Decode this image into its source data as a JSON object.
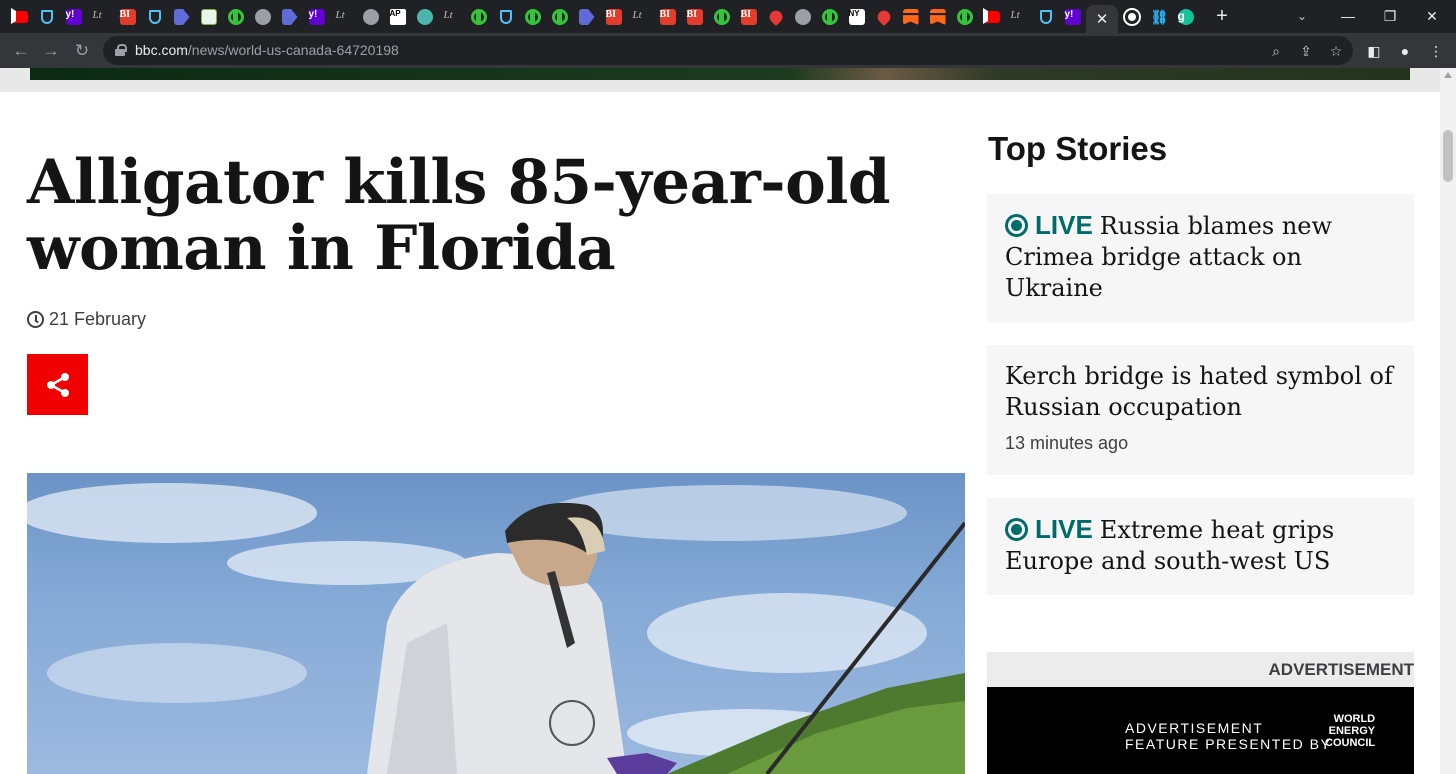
{
  "browser": {
    "tabs": [
      {
        "icon": "youtube-icon"
      },
      {
        "icon": "shield-icon"
      },
      {
        "icon": "yahoo-icon",
        "glyph": "y!"
      },
      {
        "icon": "lt-icon",
        "glyph": "Lt"
      },
      {
        "icon": "business-insider-icon",
        "glyph": "BI"
      },
      {
        "icon": "shield-icon"
      },
      {
        "icon": "arrow-icon"
      },
      {
        "icon": "grid-icon"
      },
      {
        "icon": "rumble-icon"
      },
      {
        "icon": "globe-icon"
      },
      {
        "icon": "arrow-icon"
      },
      {
        "icon": "yahoo-icon",
        "glyph": "y!"
      },
      {
        "icon": "lt-icon",
        "glyph": "Lt"
      },
      {
        "icon": "globe-icon"
      },
      {
        "icon": "ap-icon",
        "glyph": "AP"
      },
      {
        "icon": "teal-icon"
      },
      {
        "icon": "lt-icon",
        "glyph": "Lt"
      },
      {
        "icon": "rumble-icon"
      },
      {
        "icon": "shield-icon"
      },
      {
        "icon": "rumble-icon"
      },
      {
        "icon": "rumble-icon"
      },
      {
        "icon": "arrow-icon"
      },
      {
        "icon": "business-insider-icon",
        "glyph": "BI"
      },
      {
        "icon": "lt-icon",
        "glyph": "Lt"
      },
      {
        "icon": "business-insider-icon",
        "glyph": "BI"
      },
      {
        "icon": "business-insider-icon",
        "glyph": "BI"
      },
      {
        "icon": "rumble-icon"
      },
      {
        "icon": "business-insider-icon",
        "glyph": "BI"
      },
      {
        "icon": "drop-icon"
      },
      {
        "icon": "globe-icon"
      },
      {
        "icon": "rumble-icon"
      },
      {
        "icon": "nyt-icon",
        "glyph": "NY"
      },
      {
        "icon": "drop-icon"
      },
      {
        "icon": "substack-icon"
      },
      {
        "icon": "substack-icon"
      },
      {
        "icon": "rumble-icon"
      },
      {
        "icon": "youtube-icon"
      },
      {
        "icon": "lt-icon",
        "glyph": "Lt"
      },
      {
        "icon": "shield-icon"
      },
      {
        "icon": "yahoo-icon",
        "glyph": "y!"
      }
    ],
    "after_tabs": [
      {
        "icon": "dot-icon"
      },
      {
        "icon": "link-icon",
        "glyph": "⛓"
      },
      {
        "icon": "grammarly-icon",
        "glyph": "g"
      }
    ],
    "active_tab_close": "✕",
    "new_tab": "+",
    "url_domain": "bbc.com",
    "url_path": "/news/world-us-canada-64720198"
  },
  "article": {
    "headline": "Alligator kills 85-year-old woman in Florida",
    "date": "21 February"
  },
  "sidebar": {
    "title": "Top Stories",
    "stories": [
      {
        "live": "LIVE",
        "title": "Russia blames new Crimea bridge attack on Ukraine",
        "meta": ""
      },
      {
        "live": "",
        "title": "Kerch bridge is hated symbol of Russian occupation",
        "meta": "13 minutes ago"
      },
      {
        "live": "LIVE",
        "title": "Extreme heat grips Europe and south-west US",
        "meta": ""
      }
    ],
    "ad_label": "ADVERTISEMENT",
    "ad_text_line1": "ADVERTISEMENT",
    "ad_text_line2": "FEATURE PRESENTED BY",
    "ad_logo_line1": "WORLD",
    "ad_logo_line2": "ENERGY",
    "ad_logo_line3": "COUNCIL"
  },
  "colors": {
    "live": "#006b6b",
    "share": "#f00000",
    "chrome_dark": "#202124"
  }
}
